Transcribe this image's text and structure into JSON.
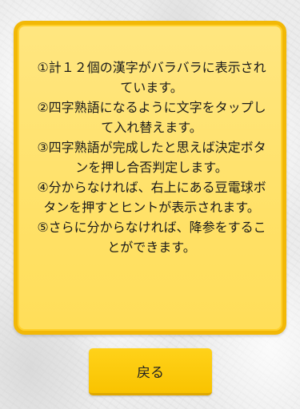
{
  "instructions": {
    "rules": [
      "①計１２個の漢字がバラバラに表示されています。",
      "②四字熟語になるように文字をタップして入れ替えます。",
      "③四字熟語が完成したと思えば決定ボタンを押し合否判定します。",
      "④分からなければ、右上にある豆電球ボタンを押すとヒントが表示されます。",
      "⑤さらに分からなければ、降参をすることができます。"
    ]
  },
  "footer": {
    "back_label": "戻る"
  },
  "colors": {
    "panel_fill": "#ffe36e",
    "panel_border": "#f2b807",
    "button_fill": "#ffcc0d"
  }
}
